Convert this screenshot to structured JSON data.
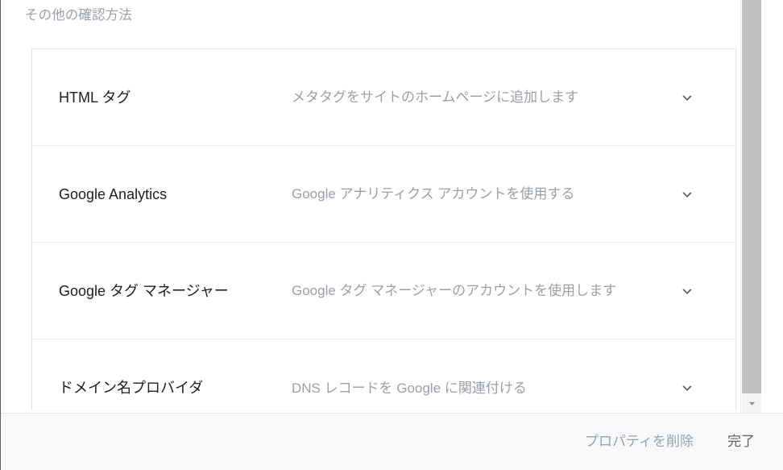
{
  "dialog": {
    "section_title": "その他の確認方法",
    "methods": [
      {
        "name": "HTML タグ",
        "description": "メタタグをサイトのホームページに追加します",
        "expander_icon": "chevron-down-icon"
      },
      {
        "name": "Google Analytics",
        "description": "Google アナリティクス アカウントを使用する",
        "expander_icon": "chevron-down-icon"
      },
      {
        "name": "Google タグ マネージャー",
        "description": "Google タグ マネージャーのアカウントを使用します",
        "expander_icon": "chevron-down-icon"
      },
      {
        "name": "ドメイン名プロバイダ",
        "description": "DNS レコードを Google に関連付ける",
        "expander_icon": "chevron-down-icon"
      }
    ],
    "footer": {
      "delete_property_label": "プロパティを削除",
      "done_label": "完了"
    },
    "scrollbar": {
      "down_arrow_icon": "triangle-down-icon"
    }
  },
  "colors": {
    "card_border": "#e3e3e3",
    "row_divider": "#ececec",
    "primary_text": "#202124",
    "secondary_text": "#9aa0a6",
    "footer_bg": "#f8f9fa",
    "scroll_thumb": "#c1c1c1"
  }
}
